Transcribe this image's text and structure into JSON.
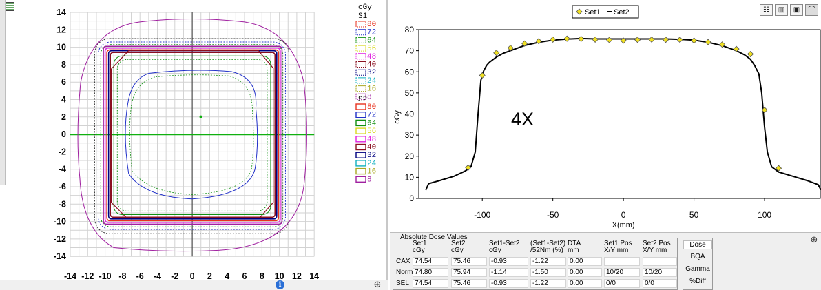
{
  "left": {
    "legend_unit": "cGy",
    "set1_label": "S1",
    "set2_label": "S2",
    "set1_levels": [
      "80",
      "72",
      "64",
      "56",
      "48",
      "40",
      "32",
      "24",
      "16",
      "8"
    ],
    "set2_levels": [
      "80",
      "72",
      "64",
      "56",
      "48",
      "40",
      "32",
      "24",
      "16",
      "8"
    ],
    "level_colors": [
      "#e8321e",
      "#2030c8",
      "#109010",
      "#d8d820",
      "#e020e0",
      "#8a1020",
      "#000080",
      "#10b0c0",
      "#a8a820",
      "#a020a0"
    ],
    "axis_ticks": [
      "-14",
      "-12",
      "-10",
      "-8",
      "-6",
      "-4",
      "-2",
      "0",
      "2",
      "4",
      "6",
      "8",
      "10",
      "12",
      "14"
    ],
    "y_ticks": [
      "14",
      "12",
      "10",
      "8",
      "6",
      "4",
      "2",
      "0",
      "-2",
      "-4",
      "-6",
      "-8",
      "-10",
      "-12",
      "-14"
    ],
    "crosshair_color": "#10b010"
  },
  "chart_data": {
    "type": "line",
    "legend": [
      "Set1",
      "Set2"
    ],
    "annotation": "4X",
    "xlabel": "X(mm)",
    "ylabel": "cGy",
    "xlim": [
      -145,
      140
    ],
    "ylim": [
      0,
      80
    ],
    "x_ticks": [
      "-100",
      "-50",
      "0",
      "50",
      "100"
    ],
    "y_ticks": [
      "0",
      "10",
      "20",
      "30",
      "40",
      "50",
      "60",
      "70",
      "80"
    ],
    "series": [
      {
        "name": "Set1",
        "marker": "diamond",
        "color": "#f0e020",
        "x": [
          -110,
          -100,
          -90,
          -80,
          -70,
          -60,
          -50,
          -40,
          -30,
          -20,
          -10,
          0,
          10,
          20,
          30,
          40,
          50,
          60,
          70,
          80,
          90,
          100,
          110
        ],
        "y": [
          14.6,
          58.3,
          69,
          71.3,
          73.4,
          74.5,
          75.3,
          75.7,
          75.6,
          75.3,
          75.1,
          74.8,
          75.2,
          75.3,
          75.2,
          75.2,
          74.8,
          74.1,
          72.9,
          70.8,
          68.4,
          41.9,
          14.3
        ]
      },
      {
        "name": "Set2",
        "marker": "line",
        "color": "#000000",
        "x": [
          -140,
          -138,
          -130,
          -120,
          -112,
          -108,
          -105,
          -103,
          -101,
          -99,
          -97,
          -95,
          -90,
          -85,
          -80,
          -70,
          -60,
          -50,
          -40,
          -30,
          -20,
          -10,
          0,
          10,
          20,
          30,
          40,
          50,
          60,
          70,
          80,
          86,
          90,
          93,
          96,
          98,
          100,
          102,
          105,
          110,
          120,
          130,
          138,
          140
        ],
        "y": [
          4,
          7,
          8.5,
          10.5,
          13,
          15,
          22,
          40,
          56,
          60.5,
          63,
          64.5,
          67,
          68.8,
          70,
          72.5,
          74,
          75,
          75.5,
          75.8,
          75.6,
          75.6,
          75.6,
          75.6,
          75.6,
          75.6,
          75.4,
          75,
          74,
          72.4,
          70,
          68,
          66,
          63,
          59,
          50,
          34,
          22,
          15,
          12.5,
          10.5,
          8.5,
          6.5,
          4
        ]
      }
    ]
  },
  "toolbar": {
    "buttons": [
      "table-icon",
      "bar-chart-icon",
      "frame-icon",
      "line-chart-icon"
    ]
  },
  "dose_table": {
    "title": "Absolute Dose Values",
    "columns": [
      {
        "top": "Set1",
        "bottom": "cGy"
      },
      {
        "top": "Set2",
        "bottom": "cGy"
      },
      {
        "top": "Set1-Set2",
        "bottom": "cGy"
      },
      {
        "top": "(Set1-Set2)",
        "bottom": "/52Nm (%)"
      },
      {
        "top": "DTA",
        "bottom": "mm"
      },
      {
        "top": "Set1 Pos",
        "bottom": "X/Y mm"
      },
      {
        "top": "Set2 Pos",
        "bottom": "X/Y mm"
      }
    ],
    "rows": [
      {
        "label": "CAX",
        "values": [
          "74.54",
          "75.46",
          "-0.93",
          "-1.22",
          "0.00",
          "",
          ""
        ]
      },
      {
        "label": "Norm",
        "values": [
          "74.80",
          "75.94",
          "-1.14",
          "-1.50",
          "0.00",
          "10/20",
          "10/20"
        ]
      },
      {
        "label": "SEL",
        "values": [
          "74.54",
          "75.46",
          "-0.93",
          "-1.22",
          "0.00",
          "0/0",
          "0/0"
        ]
      }
    ],
    "modes": [
      "Dose",
      "BQA",
      "Gamma",
      "%Diff"
    ]
  }
}
